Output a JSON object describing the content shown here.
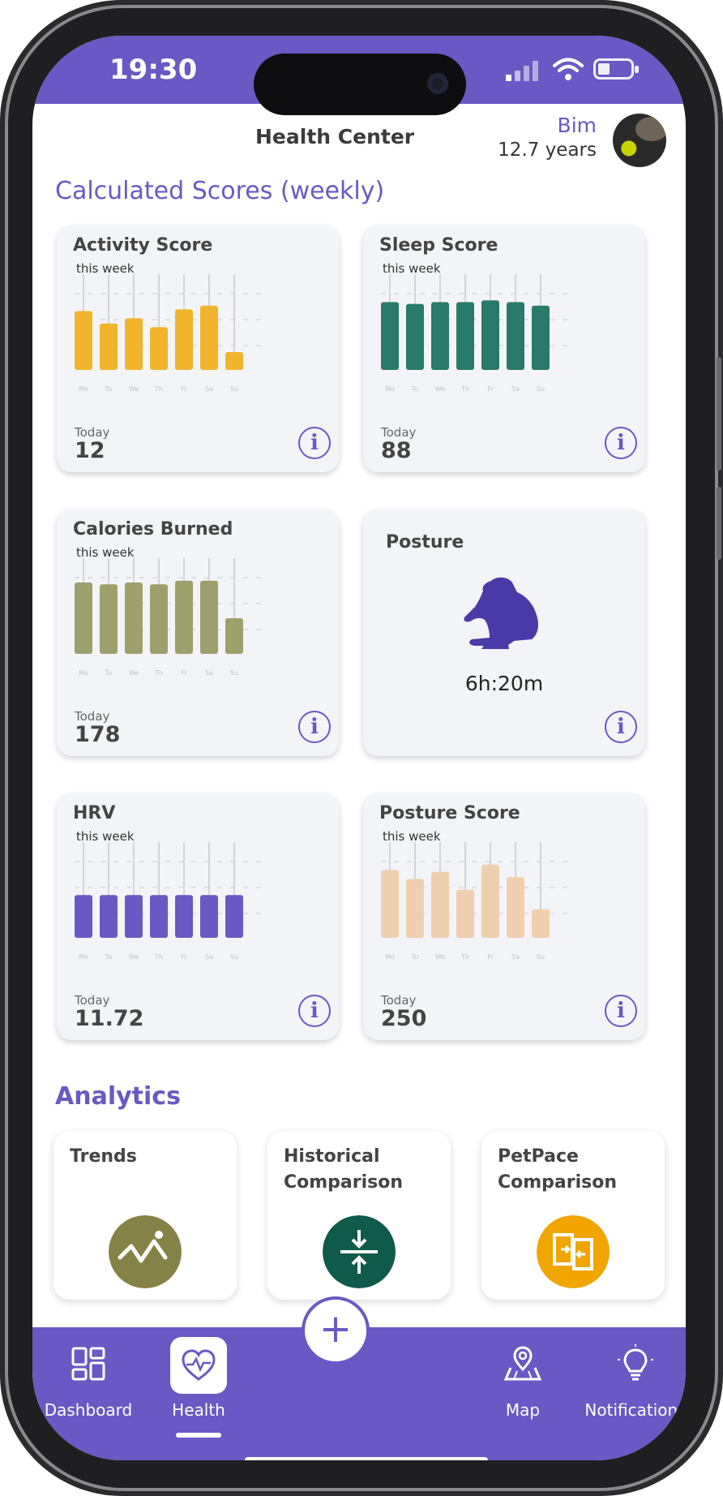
{
  "status_bar": {
    "time": "19:30"
  },
  "header": {
    "title": "Health Center",
    "pet_name": "Bim",
    "pet_age": "12.7 years"
  },
  "sections": {
    "scores_title": "Calculated Scores (weekly)",
    "analytics_title": "Analytics"
  },
  "day_labels": [
    "Mo",
    "Tu",
    "We",
    "Th",
    "Fr",
    "Sa",
    "Su"
  ],
  "cards": {
    "activity": {
      "title": "Activity Score",
      "subtitle": "this week",
      "today_label": "Today",
      "today_value": "12",
      "color": "#f0b52d"
    },
    "sleep": {
      "title": "Sleep Score",
      "subtitle": "this week",
      "today_label": "Today",
      "today_value": "88",
      "color": "#2a7a6b"
    },
    "calories": {
      "title": "Calories Burned",
      "subtitle": "this week",
      "today_label": "Today",
      "today_value": "178",
      "color": "#9ea06c"
    },
    "posture": {
      "title": "Posture",
      "value": "6h:20m",
      "icon": "dog-lying-icon",
      "color": "#4a3aa8"
    },
    "hrv": {
      "title": "HRV",
      "subtitle": "this week",
      "today_label": "Today",
      "today_value": "11.72",
      "color": "#6a58c4"
    },
    "posture_score": {
      "title": "Posture Score",
      "subtitle": "this week",
      "today_label": "Today",
      "today_value": "250",
      "color": "#f0cfae"
    }
  },
  "chart_data": [
    {
      "type": "bar",
      "title": "Activity Score",
      "categories": [
        "Mo",
        "Tu",
        "We",
        "Th",
        "Fr",
        "Sa",
        "Su"
      ],
      "values": [
        0.66,
        0.52,
        0.58,
        0.48,
        0.68,
        0.72,
        0.2
      ],
      "ylim": [
        0,
        1
      ]
    },
    {
      "type": "bar",
      "title": "Sleep Score",
      "categories": [
        "Mo",
        "Tu",
        "We",
        "Th",
        "Fr",
        "Sa",
        "Su"
      ],
      "values": [
        0.76,
        0.74,
        0.76,
        0.76,
        0.78,
        0.76,
        0.72
      ],
      "ylim": [
        0,
        1
      ]
    },
    {
      "type": "bar",
      "title": "Calories Burned",
      "categories": [
        "Mo",
        "Tu",
        "We",
        "Th",
        "Fr",
        "Sa",
        "Su"
      ],
      "values": [
        0.8,
        0.78,
        0.8,
        0.78,
        0.82,
        0.82,
        0.4
      ],
      "ylim": [
        0,
        1
      ]
    },
    {
      "type": "bar",
      "title": "HRV",
      "categories": [
        "Mo",
        "Tu",
        "We",
        "Th",
        "Fr",
        "Sa",
        "Su"
      ],
      "values": [
        0.48,
        0.48,
        0.48,
        0.48,
        0.48,
        0.48,
        0.48
      ],
      "ylim": [
        0,
        1
      ]
    },
    {
      "type": "bar",
      "title": "Posture Score",
      "categories": [
        "Mo",
        "Tu",
        "We",
        "Th",
        "Fr",
        "Sa",
        "Su"
      ],
      "values": [
        0.76,
        0.66,
        0.74,
        0.54,
        0.82,
        0.68,
        0.32
      ],
      "ylim": [
        0,
        1
      ]
    }
  ],
  "analytics": [
    {
      "title": "Trends",
      "icon": "trend-line-icon",
      "color": "#858247"
    },
    {
      "title": "Historical Comparison",
      "icon": "compress-arrows-icon",
      "color": "#0f5a4a"
    },
    {
      "title": "PetPace Comparison",
      "icon": "compare-swap-icon",
      "color": "#f0a500"
    }
  ],
  "tabbar": {
    "dashboard": "Dashboard",
    "health": "Health",
    "add": "+",
    "map": "Map",
    "notifications": "Notifications"
  }
}
